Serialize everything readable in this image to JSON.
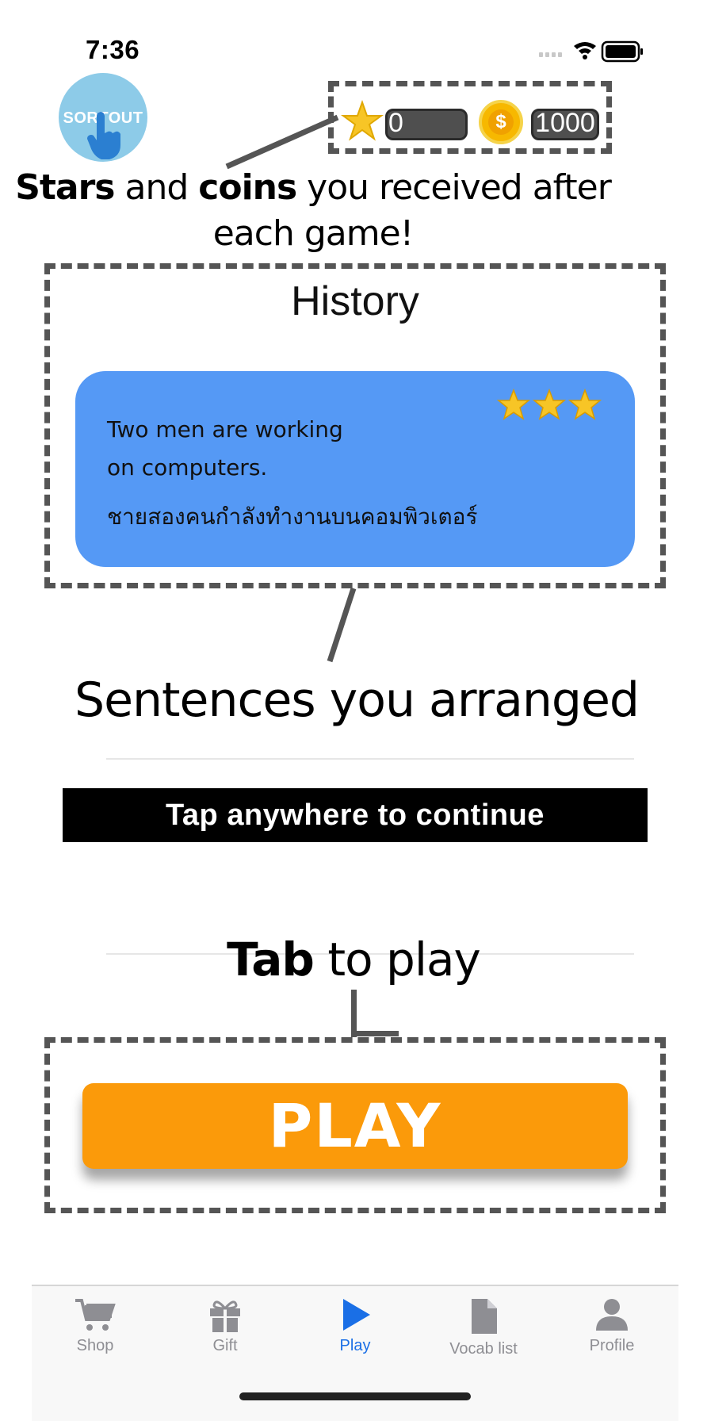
{
  "status": {
    "time": "7:36"
  },
  "logo": {
    "text": "SORTOUT"
  },
  "wallet": {
    "stars": "0",
    "coins": "1000"
  },
  "captions": {
    "stars_bold": "Stars",
    "and": " and ",
    "coins_bold": "coins",
    "rest": " you received after",
    "line2": "each game!",
    "sentences": "Sentences you arranged",
    "tab_bold": "Tab",
    "tab_rest": " to play"
  },
  "history": {
    "title": "History",
    "card": {
      "en_line1": "Two men are working",
      "en_line2": "on computers.",
      "th": "ชายสองคนกำลังทำงานบนคอมพิวเตอร์",
      "star_count": 3
    }
  },
  "continue_banner": "Tap anywhere to continue",
  "play_button": "PLAY",
  "tabs": [
    {
      "label": "Shop",
      "icon": "cart-icon"
    },
    {
      "label": "Gift",
      "icon": "gift-icon"
    },
    {
      "label": "Play",
      "icon": "play-icon",
      "active": true
    },
    {
      "label": "Vocab list",
      "icon": "document-icon"
    },
    {
      "label": "Profile",
      "icon": "person-icon"
    }
  ],
  "colors": {
    "accent": "#1a6fe6",
    "card": "#5599f5",
    "play": "#fb9a0a",
    "logo": "#8dcbe8"
  }
}
